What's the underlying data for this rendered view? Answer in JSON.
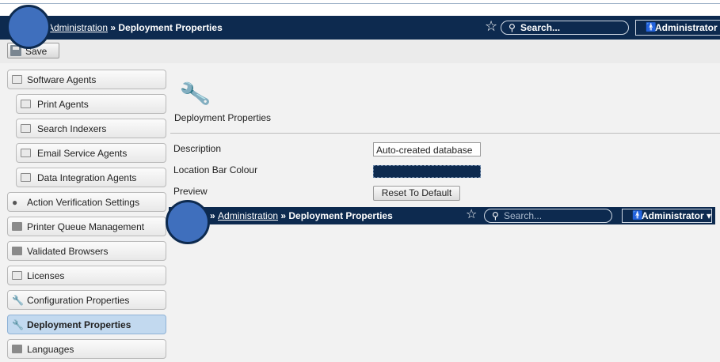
{
  "locbar": {
    "link": "Administration",
    "sep": " » ",
    "current": "Deployment Properties",
    "search_placeholder": "Search...",
    "user": "Administrator ▾"
  },
  "toolbar": {
    "save_label": "Save"
  },
  "sidebar": {
    "items": [
      {
        "label": "Software Agents"
      },
      {
        "label": "Print Agents"
      },
      {
        "label": "Search Indexers"
      },
      {
        "label": "Email Service Agents"
      },
      {
        "label": "Data Integration Agents"
      },
      {
        "label": "Action Verification Settings"
      },
      {
        "label": "Printer Queue Management"
      },
      {
        "label": "Validated Browsers"
      },
      {
        "label": "Licenses"
      },
      {
        "label": "Configuration Properties"
      },
      {
        "label": "Deployment Properties"
      },
      {
        "label": "Languages"
      }
    ]
  },
  "main": {
    "title": "Deployment Properties",
    "fields": {
      "description_label": "Description",
      "description_value": "Auto-created database",
      "location_bar_colour_label": "Location Bar Colour",
      "location_bar_colour_value": "#0d2a4f",
      "preview_label": "Preview",
      "reset_label": "Reset To Default"
    }
  },
  "preview_bar": {
    "prefix": "» ",
    "link": "Administration",
    "sep": " » ",
    "current": "Deployment Properties",
    "search_placeholder": "Search...",
    "user": "Administrator ▾"
  },
  "colors": {
    "location_bar": "#0d2a4f",
    "active_item": "#c2d9ef",
    "marker": "#3f6fbd"
  }
}
